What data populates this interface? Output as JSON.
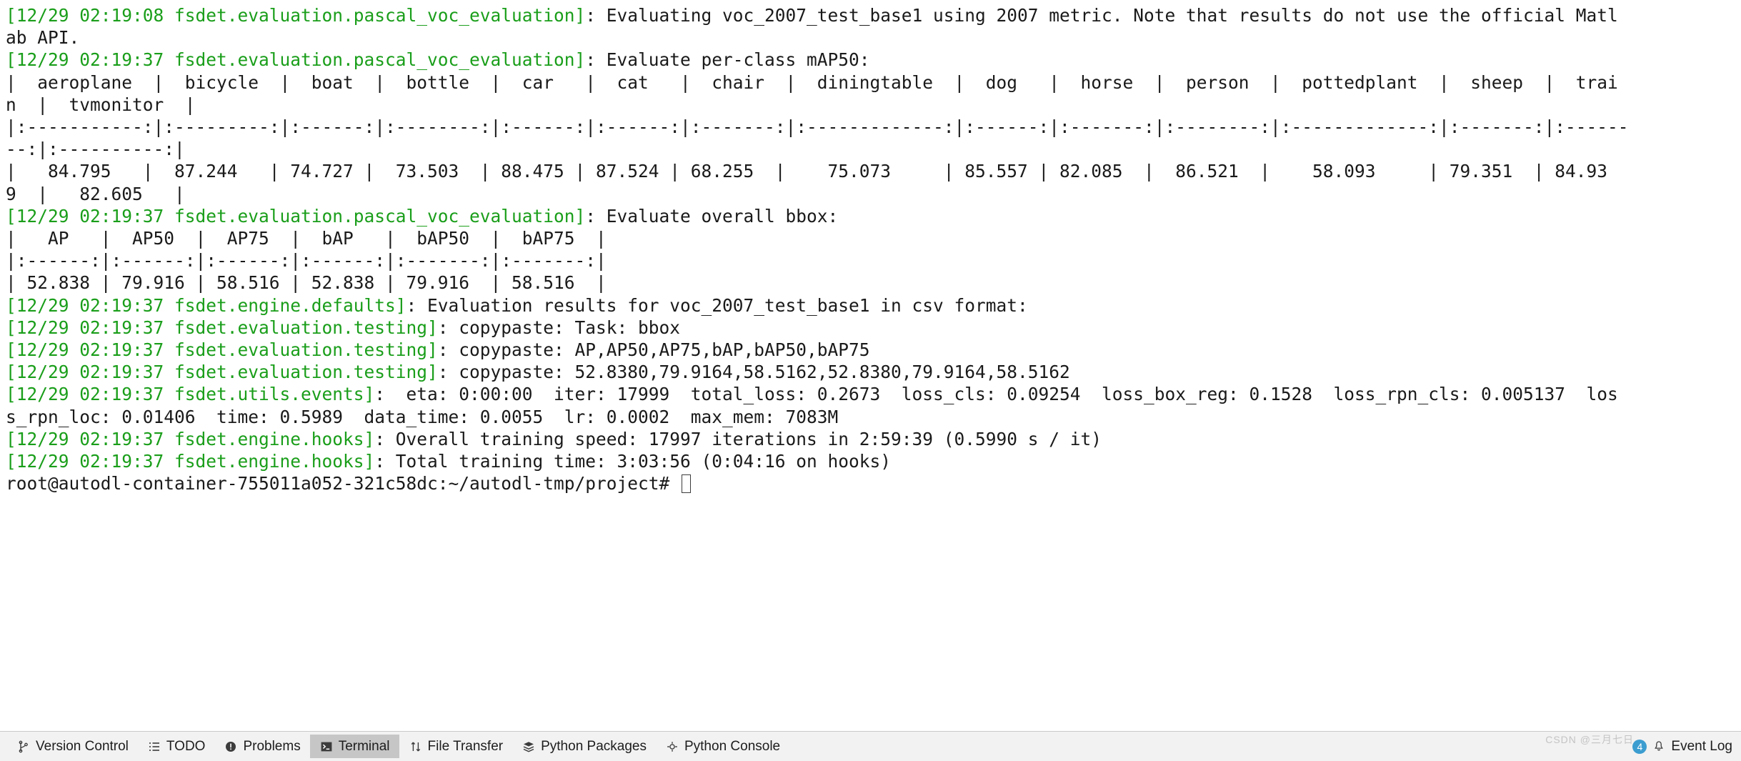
{
  "window": {
    "title": "Terminal"
  },
  "terminal": {
    "prompt": "root@autodl-container-755011a052-321c58dc:~/autodl-tmp/project# ",
    "lines": [
      {
        "green": "[12/29 02:19:08 fsdet.evaluation.pascal_voc_evaluation]",
        "plain": ": Evaluating voc_2007_test_base1 using 2007 metric. Note that results do not use the official Matl"
      },
      {
        "green": "",
        "plain": "ab API."
      },
      {
        "green": "[12/29 02:19:37 fsdet.evaluation.pascal_voc_evaluation]",
        "plain": ": Evaluate per-class mAP50:"
      },
      {
        "green": "",
        "plain": "|  aeroplane  |  bicycle  |  boat  |  bottle  |  car   |  cat   |  chair  |  diningtable  |  dog   |  horse  |  person  |  pottedplant  |  sheep  |  trai"
      },
      {
        "green": "",
        "plain": "n  |  tvmonitor  |"
      },
      {
        "green": "",
        "plain": "|:-----------:|:---------:|:------:|:--------:|:------:|:------:|:-------:|:-------------:|:------:|:-------:|:--------:|:-------------:|:-------:|:------"
      },
      {
        "green": "",
        "plain": "--:|:----------:|"
      },
      {
        "green": "",
        "plain": "|   84.795   |  87.244   | 74.727 |  73.503  | 88.475 | 87.524 | 68.255  |    75.073     | 85.557 | 82.085  |  86.521  |    58.093     | 79.351  | 84.93"
      },
      {
        "green": "",
        "plain": "9  |   82.605   |"
      },
      {
        "green": "[12/29 02:19:37 fsdet.evaluation.pascal_voc_evaluation]",
        "plain": ": Evaluate overall bbox:"
      },
      {
        "green": "",
        "plain": "|   AP   |  AP50  |  AP75  |  bAP   |  bAP50  |  bAP75  |"
      },
      {
        "green": "",
        "plain": "|:------:|:------:|:------:|:------:|:-------:|:-------:|"
      },
      {
        "green": "",
        "plain": "| 52.838 | 79.916 | 58.516 | 52.838 | 79.916  | 58.516  |"
      },
      {
        "green": "[12/29 02:19:37 fsdet.engine.defaults]",
        "plain": ": Evaluation results for voc_2007_test_base1 in csv format:"
      },
      {
        "green": "[12/29 02:19:37 fsdet.evaluation.testing]",
        "plain": ": copypaste: Task: bbox"
      },
      {
        "green": "[12/29 02:19:37 fsdet.evaluation.testing]",
        "plain": ": copypaste: AP,AP50,AP75,bAP,bAP50,bAP75"
      },
      {
        "green": "[12/29 02:19:37 fsdet.evaluation.testing]",
        "plain": ": copypaste: 52.8380,79.9164,58.5162,52.8380,79.9164,58.5162"
      },
      {
        "green": "[12/29 02:19:37 fsdet.utils.events]",
        "plain": ":  eta: 0:00:00  iter: 17999  total_loss: 0.2673  loss_cls: 0.09254  loss_box_reg: 0.1528  loss_rpn_cls: 0.005137  los"
      },
      {
        "green": "",
        "plain": "s_rpn_loc: 0.01406  time: 0.5989  data_time: 0.0055  lr: 0.0002  max_mem: 7083M"
      },
      {
        "green": "[12/29 02:19:37 fsdet.engine.hooks]",
        "plain": ": Overall training speed: 17997 iterations in 2:59:39 (0.5990 s / it)"
      },
      {
        "green": "[12/29 02:19:37 fsdet.engine.hooks]",
        "plain": ": Total training time: 3:03:56 (0:04:16 on hooks)"
      }
    ],
    "colors": {
      "log_prefix": "#1a9e1a",
      "text": "#1a1a1a",
      "background": "#ffffff"
    },
    "eval_tables": {
      "per_class_map50": {
        "classes": [
          "aeroplane",
          "bicycle",
          "boat",
          "bottle",
          "car",
          "cat",
          "chair",
          "diningtable",
          "dog",
          "horse",
          "person",
          "pottedplant",
          "sheep",
          "train",
          "tvmonitor"
        ],
        "values": [
          84.795,
          87.244,
          74.727,
          73.503,
          88.475,
          87.524,
          68.255,
          75.073,
          85.557,
          82.085,
          86.521,
          58.093,
          79.351,
          84.939,
          82.605
        ]
      },
      "overall_bbox": {
        "columns": [
          "AP",
          "AP50",
          "AP75",
          "bAP",
          "bAP50",
          "bAP75"
        ],
        "values": [
          52.838,
          79.916,
          58.516,
          52.838,
          79.916,
          58.516
        ]
      },
      "csv_values": [
        52.838,
        79.9164,
        58.5162,
        52.838,
        79.9164,
        58.5162
      ]
    },
    "metrics": {
      "eta": "0:00:00",
      "iter": "17999",
      "total_loss": "0.2673",
      "loss_cls": "0.09254",
      "loss_box_reg": "0.1528",
      "loss_rpn_cls": "0.005137",
      "loss_rpn_loc": "0.01406",
      "time": "0.5989",
      "data_time": "0.0055",
      "lr": "0.0002",
      "max_mem": "7083M",
      "overall_speed": "17997 iterations in 2:59:39 (0.5990 s / it)",
      "total_training_time": "3:03:56 (0:04:16 on hooks)"
    }
  },
  "statusbar": {
    "items": [
      {
        "label": "Version Control",
        "icon": "branch-icon",
        "active": false
      },
      {
        "label": "TODO",
        "icon": "list-icon",
        "active": false
      },
      {
        "label": "Problems",
        "icon": "exclamation-circle-icon",
        "active": false
      },
      {
        "label": "Terminal",
        "icon": "terminal-icon",
        "active": true
      },
      {
        "label": "File Transfer",
        "icon": "updown-arrows-icon",
        "active": false
      },
      {
        "label": "Python Packages",
        "icon": "layers-icon",
        "active": false
      },
      {
        "label": "Python Console",
        "icon": "python-icon",
        "active": false
      }
    ],
    "event_log": {
      "label": "Event Log",
      "count": "4",
      "icon": "bell-icon",
      "badge_color": "#3c9dd0"
    },
    "watermark": "CSDN @三月七日"
  }
}
